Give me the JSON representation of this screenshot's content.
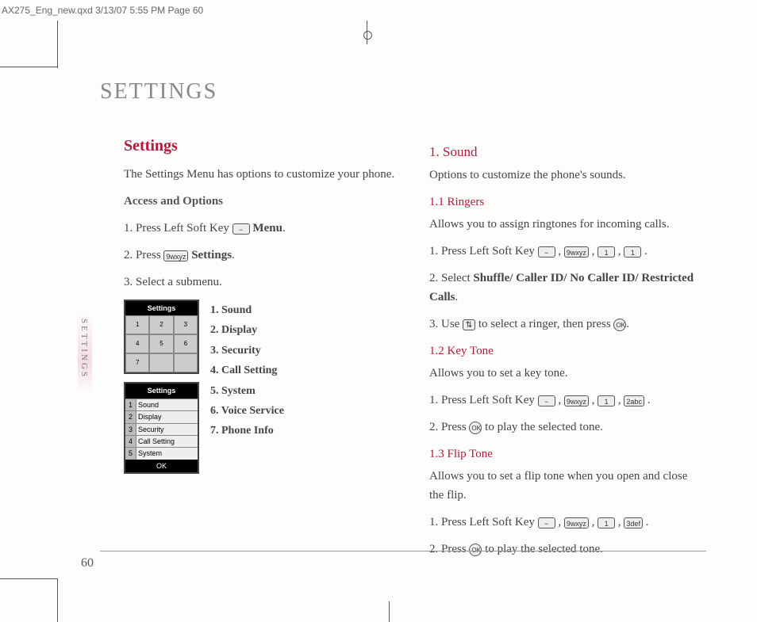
{
  "header_meta": "AX275_Eng_new.qxd  3/13/07  5:55 PM  Page 60",
  "page_title": "SETTINGS",
  "side_tab": "SETTINGS",
  "page_number": "60",
  "left": {
    "h2": "Settings",
    "intro": "The Settings Menu has options to customize your phone.",
    "access_heading": "Access and Options",
    "step1_a": "1. Press Left Soft Key ",
    "step1_key": "−",
    "step1_b": " Menu",
    "step1_c": ".",
    "step2_a": "2. Press ",
    "step2_key": "9wxyz",
    "step2_b": " Settings",
    "step2_c": ".",
    "step3": "3. Select a submenu.",
    "screen1_title": "Settings",
    "screen1_cells": [
      "1",
      "2",
      "3",
      "4",
      "5",
      "6",
      "7",
      "",
      ""
    ],
    "screen2_title": "Settings",
    "screen2_items": [
      {
        "idx": "1",
        "txt": "Sound"
      },
      {
        "idx": "2",
        "txt": "Display"
      },
      {
        "idx": "3",
        "txt": "Security"
      },
      {
        "idx": "4",
        "txt": "Call Setting"
      },
      {
        "idx": "5",
        "txt": "System"
      }
    ],
    "screen2_softkey": "OK",
    "submenu": [
      "1. Sound",
      "2. Display",
      "3. Security",
      "4. Call Setting",
      "5. System",
      "6. Voice Service",
      "7. Phone Info"
    ]
  },
  "right": {
    "h3_sound": "1. Sound",
    "sound_intro": "Options to customize the phone's sounds.",
    "h4_ringers": "1.1 Ringers",
    "ringers_intro": "Allows you to assign ringtones for incoming calls.",
    "r_step1_a": "1. Press Left Soft Key ",
    "r_step1_k1": "−",
    "r_step1_k2": "9wxyz",
    "r_step1_k3": "1",
    "r_step1_k4": "1",
    "r_step1_sep": " , ",
    "r_step1_end": " .",
    "r_step2_a": "2. Select ",
    "r_step2_b": "Shuffle/ Caller ID/ No Caller ID/ Restricted Calls",
    "r_step2_c": ".",
    "r_step3_a": "3. Use ",
    "r_step3_navkey": "⇅",
    "r_step3_b": " to select a ringer, then press ",
    "r_step3_ok": "OK",
    "r_step3_c": ".",
    "h4_keytone": "1.2 Key Tone",
    "keytone_intro": "Allows you to set a key tone.",
    "k_step1_a": "1. Press Left Soft Key ",
    "k_step1_k1": "−",
    "k_step1_k2": "9wxyz",
    "k_step1_k3": "1",
    "k_step1_k4": "2abc",
    "k_step2_a": "2. Press ",
    "k_step2_ok": "OK",
    "k_step2_b": " to play the selected tone.",
    "h4_fliptone": "1.3 Flip Tone",
    "fliptone_intro": "Allows you to set a flip tone when you open and close the flip.",
    "f_step1_a": "1. Press Left Soft Key ",
    "f_step1_k1": "−",
    "f_step1_k2": "9wxyz",
    "f_step1_k3": "1",
    "f_step1_k4": "3def",
    "f_step2_a": "2. Press ",
    "f_step2_ok": "OK",
    "f_step2_b": " to play the selected tone."
  }
}
